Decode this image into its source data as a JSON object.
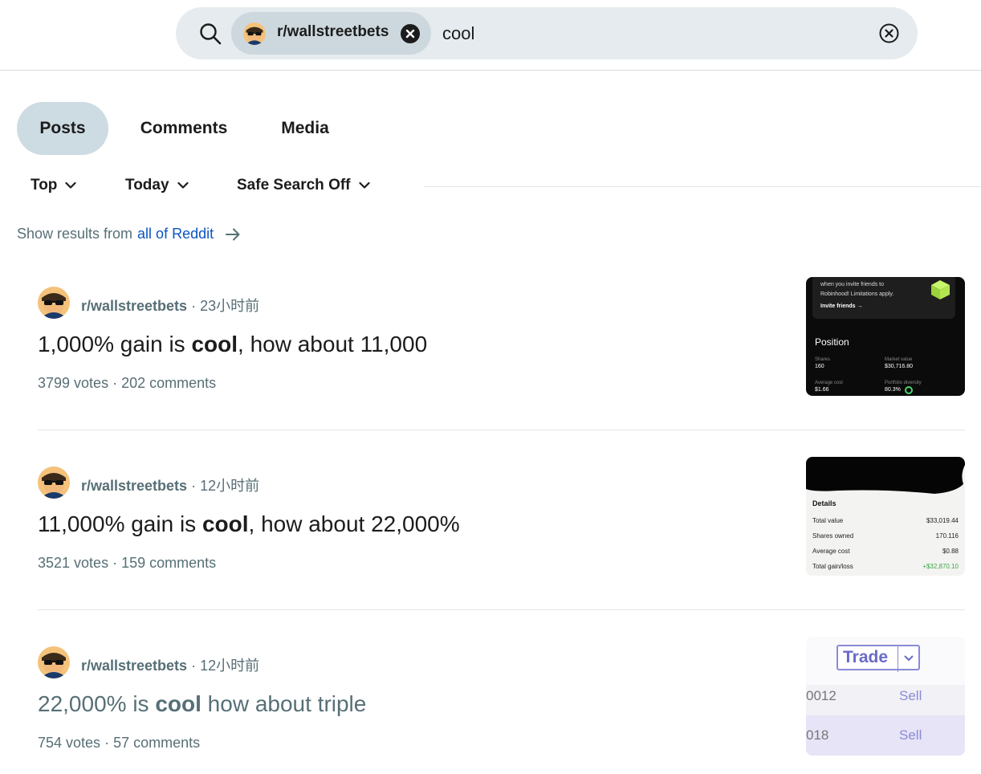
{
  "search": {
    "community": "r/wallstreetbets",
    "query": "cool"
  },
  "tabs": [
    {
      "label": "Posts"
    },
    {
      "label": "Comments"
    },
    {
      "label": "Media"
    }
  ],
  "filters": {
    "sort": "Top",
    "time": "Today",
    "safe_search": "Safe Search Off"
  },
  "global_hint": {
    "prefix": "Show results from",
    "link": "all of Reddit"
  },
  "results": [
    {
      "subreddit": "r/wallstreetbets",
      "time": "23小时前",
      "title_pre": "1,000% gain is ",
      "title_bold": "cool",
      "title_post": ", how about 11,000",
      "votes": "3799 votes",
      "comments": "202 comments",
      "thumb": {
        "line1": "when you invite friends to",
        "line2": "Robinhood! Limitations apply.",
        "link": "Invite friends →",
        "heading": "Position",
        "shares_label": "Shares",
        "shares": "160",
        "market_label": "Market value",
        "market": "$30,716.80",
        "avg_label": "Average cost",
        "avg": "$1.66",
        "div_label": "Portfolio diversity",
        "div": "80.3%"
      }
    },
    {
      "subreddit": "r/wallstreetbets",
      "time": "12小时前",
      "title_pre": "11,000% gain is ",
      "title_bold": "cool",
      "title_post": ", how about 22,000%",
      "votes": "3521 votes",
      "comments": "159 comments",
      "thumb": {
        "heading": "Details",
        "rows": [
          {
            "label": "Total value",
            "value": "$33,019.44"
          },
          {
            "label": "Shares owned",
            "value": "170.116"
          },
          {
            "label": "Average cost",
            "value": "$0.88"
          },
          {
            "label": "Total gain/loss",
            "value": "+$32,870.10"
          }
        ]
      }
    },
    {
      "subreddit": "r/wallstreetbets",
      "time": "12小时前",
      "title_pre": "22,000% is ",
      "title_bold": "cool",
      "title_post": " how about triple",
      "votes": "754 votes",
      "comments": "57 comments",
      "thumb": {
        "button": "Trade",
        "row1_left": "0012",
        "row1_right": "Sell",
        "row2_left": "018",
        "row2_right": "Sell"
      }
    }
  ],
  "colors": {
    "accent_link": "#0a55c2",
    "muted_text": "#576f76",
    "active_tab": "#cddbe2",
    "search_bg": "#e5ebee"
  }
}
